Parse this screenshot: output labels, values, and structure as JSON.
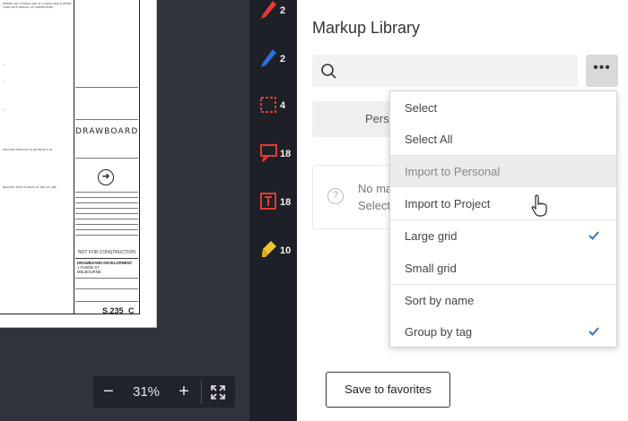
{
  "drawing": {
    "brand": "DRAWBOARD",
    "not_for_construction": "NOT FOR CONSTRUCTION",
    "developer_lines": [
      "DRAWBOARD DEVELOPMENT",
      "1 FUNGE ST",
      "MELBOURNE"
    ],
    "sheet_number": "S.235",
    "revision": "C"
  },
  "zoom": {
    "minus": "−",
    "value": "31%",
    "plus": "+"
  },
  "tools": [
    {
      "name": "red-pen",
      "count": "2",
      "color": "#e53935"
    },
    {
      "name": "blue-pen",
      "count": "2",
      "color": "#2e6fe0"
    },
    {
      "name": "dashed-rectangle",
      "count": "4",
      "color": "#e53935"
    },
    {
      "name": "callout",
      "count": "18",
      "color": "#e53935"
    },
    {
      "name": "text-box",
      "count": "18",
      "color": "#e53935"
    },
    {
      "name": "highlighter",
      "count": "10",
      "color": "#f2c230"
    }
  ],
  "panel": {
    "title": "Markup Library",
    "segment_label": "Perso",
    "info_line1": "No ma",
    "info_line2": "Select",
    "save_favorites": "Save to favorites"
  },
  "menu": {
    "items": [
      {
        "label": "Select"
      },
      {
        "label": "Select All"
      },
      {
        "label": "Import to Personal"
      },
      {
        "label": "Import to Project"
      },
      {
        "label": "Large grid",
        "checked": true
      },
      {
        "label": "Small grid"
      },
      {
        "label": "Sort by name"
      },
      {
        "label": "Group by tag",
        "checked": true
      }
    ],
    "check_color": "#3a6fc4"
  }
}
